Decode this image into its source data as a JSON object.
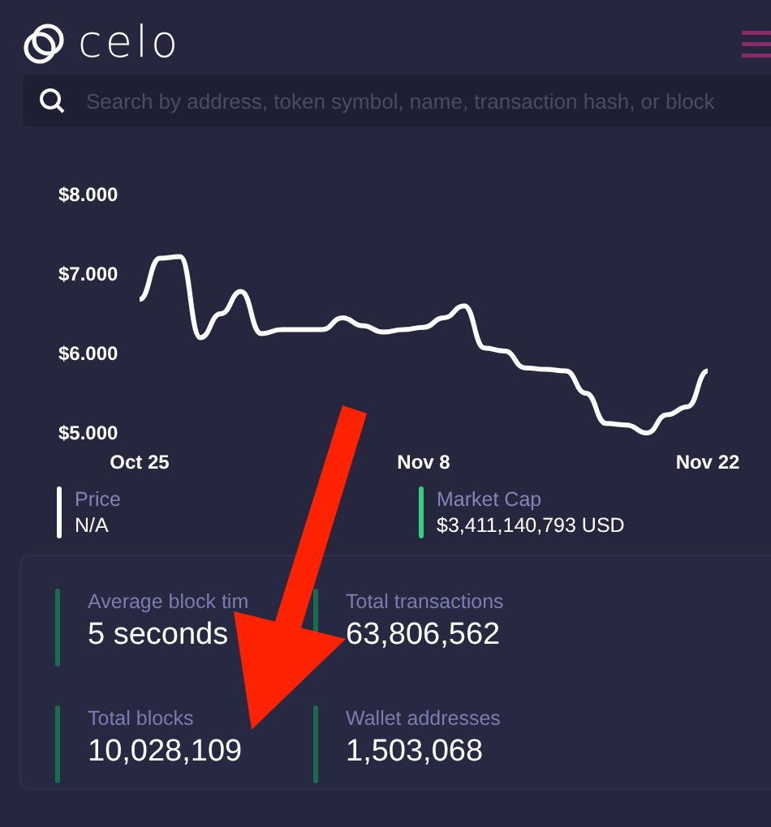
{
  "header": {
    "logo": "celo"
  },
  "search": {
    "placeholder": "Search by address, token symbol, name, transaction hash, or block"
  },
  "chart_data": {
    "type": "line",
    "categories": [
      "Oct 25",
      null,
      null,
      null,
      null,
      null,
      null,
      null,
      null,
      null,
      null,
      null,
      null,
      null,
      "Nov 8",
      null,
      null,
      null,
      null,
      null,
      null,
      null,
      null,
      null,
      null,
      null,
      null,
      null,
      "Nov 22"
    ],
    "ylim": [
      5,
      8
    ],
    "values": [
      6.68,
      7.2,
      7.22,
      6.2,
      6.5,
      6.78,
      6.25,
      6.3,
      6.3,
      6.3,
      6.45,
      6.35,
      6.27,
      6.3,
      6.33,
      6.45,
      6.6,
      6.07,
      6.03,
      5.82,
      5.8,
      5.78,
      5.5,
      5.12,
      5.1,
      5.0,
      5.23,
      5.33,
      5.78
    ],
    "yticks": [
      {
        "value": 8,
        "label": "$8.000"
      },
      {
        "value": 7,
        "label": "$7.000"
      },
      {
        "value": 6,
        "label": "$6.000"
      },
      {
        "value": 5,
        "label": "$5.000"
      }
    ]
  },
  "legend": [
    {
      "label": "Price",
      "value": "N/A",
      "color": "#ffffff"
    },
    {
      "label": "Market Cap",
      "value": "$3,411,140,793 USD",
      "color": "#35d07f"
    }
  ],
  "stats": [
    {
      "label": "Average block tim",
      "value": "5 seconds"
    },
    {
      "label": "Total transactions",
      "value": "63,806,562"
    },
    {
      "label": "Total blocks",
      "value": "10,028,109"
    },
    {
      "label": "Wallet addresses",
      "value": "1,503,068"
    }
  ]
}
